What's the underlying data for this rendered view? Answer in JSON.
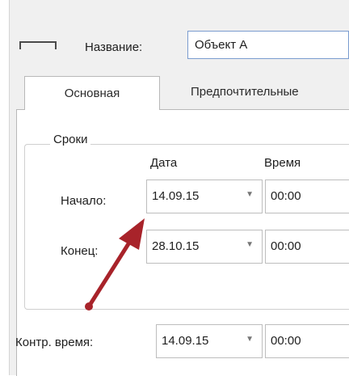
{
  "header": {
    "name_label": "Название:",
    "name_value": "Объект А"
  },
  "tabs": [
    {
      "label": "Основная",
      "active": true
    },
    {
      "label": "Предпочтительные",
      "active": false
    }
  ],
  "terms_group": {
    "title": "Сроки",
    "col_date": "Дата",
    "col_time": "Время",
    "rows": [
      {
        "label": "Начало:",
        "date": "14.09.15",
        "time": "00:00"
      },
      {
        "label": "Конец:",
        "date": "28.10.15",
        "time": "00:00"
      }
    ]
  },
  "control_time": {
    "label": "Контр. время:",
    "date": "14.09.15",
    "time": "00:00"
  },
  "icons": {
    "dropdown_arrow": "chevron-down-icon",
    "frame": "window-frame-icon",
    "annotation": "red-arrow"
  },
  "colors": {
    "annotation_arrow": "#a8232a",
    "textbox_border": "#7a9ccf"
  }
}
